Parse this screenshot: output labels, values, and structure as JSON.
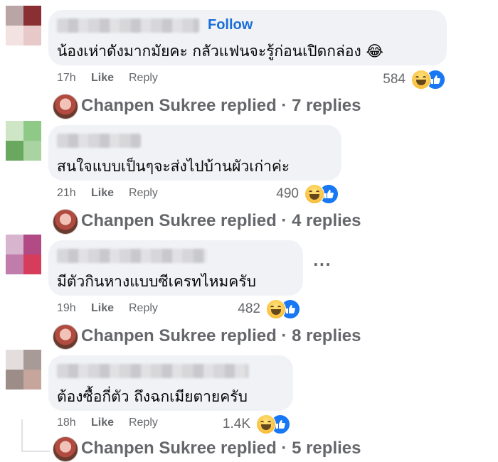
{
  "follow_label": "Follow",
  "more_options_label": "···",
  "comments": [
    {
      "text": "น้องเห่าดังมากมัยคะ กลัวแฟนจะรู้ก่อนเปิดกล่อง 😂",
      "time": "17h",
      "like_label": "Like",
      "reply_label": "Reply",
      "reaction_count": "584",
      "reactions": [
        "haha-icon",
        "like-icon"
      ],
      "replied": "Chanpen Sukree replied · 7 replies"
    },
    {
      "text": "สนใจแบบเป็นๆจะส่งไปบ้านผัวเก่าค่ะ",
      "time": "21h",
      "like_label": "Like",
      "reply_label": "Reply",
      "reaction_count": "490",
      "reactions": [
        "haha-icon",
        "like-icon"
      ],
      "replied": "Chanpen Sukree replied · 4 replies"
    },
    {
      "text": "มีตัวกินหางแบบซีเครทไหมครับ",
      "time": "19h",
      "like_label": "Like",
      "reply_label": "Reply",
      "reaction_count": "482",
      "reactions": [
        "haha-icon",
        "like-icon"
      ],
      "replied": "Chanpen Sukree replied · 8 replies"
    },
    {
      "text": "ต้องซื้อกี่ตัว ถึงฉกเมียตายครับ",
      "time": "18h",
      "like_label": "Like",
      "reply_label": "Reply",
      "reaction_count": "1.4K",
      "reactions": [
        "haha-icon",
        "like-icon"
      ],
      "replied": "Chanpen Sukree replied · 5 replies"
    }
  ],
  "colors": {
    "bubble": "#f0f2f5",
    "follow": "#1a6ed8",
    "meta_text": "#65676b",
    "like_blue": "#1877f2"
  }
}
